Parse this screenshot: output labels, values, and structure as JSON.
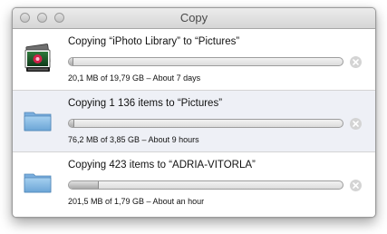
{
  "window": {
    "title": "Copy"
  },
  "colors": {
    "selected_row": "#eef0f6",
    "folder_blue": "#86b9e3",
    "progress_fill": "#b8b8b8"
  },
  "items": [
    {
      "icon": "iphoto-library-icon",
      "title": "Copying “iPhoto Library” to “Pictures”",
      "status": "20,1 MB of 19,79 GB – About 7 days",
      "progress": 0.001
    },
    {
      "icon": "folder-icon",
      "title": "Copying 1 136 items to “Pictures”",
      "status": "76,2 MB of 3,85 GB – About 9 hours",
      "progress": 0.02
    },
    {
      "icon": "folder-icon",
      "title": "Copying 423 items to “ADRIA-VITORLA”",
      "status": "201,5 MB of 1,79 GB – About an hour",
      "progress": 0.11
    }
  ]
}
